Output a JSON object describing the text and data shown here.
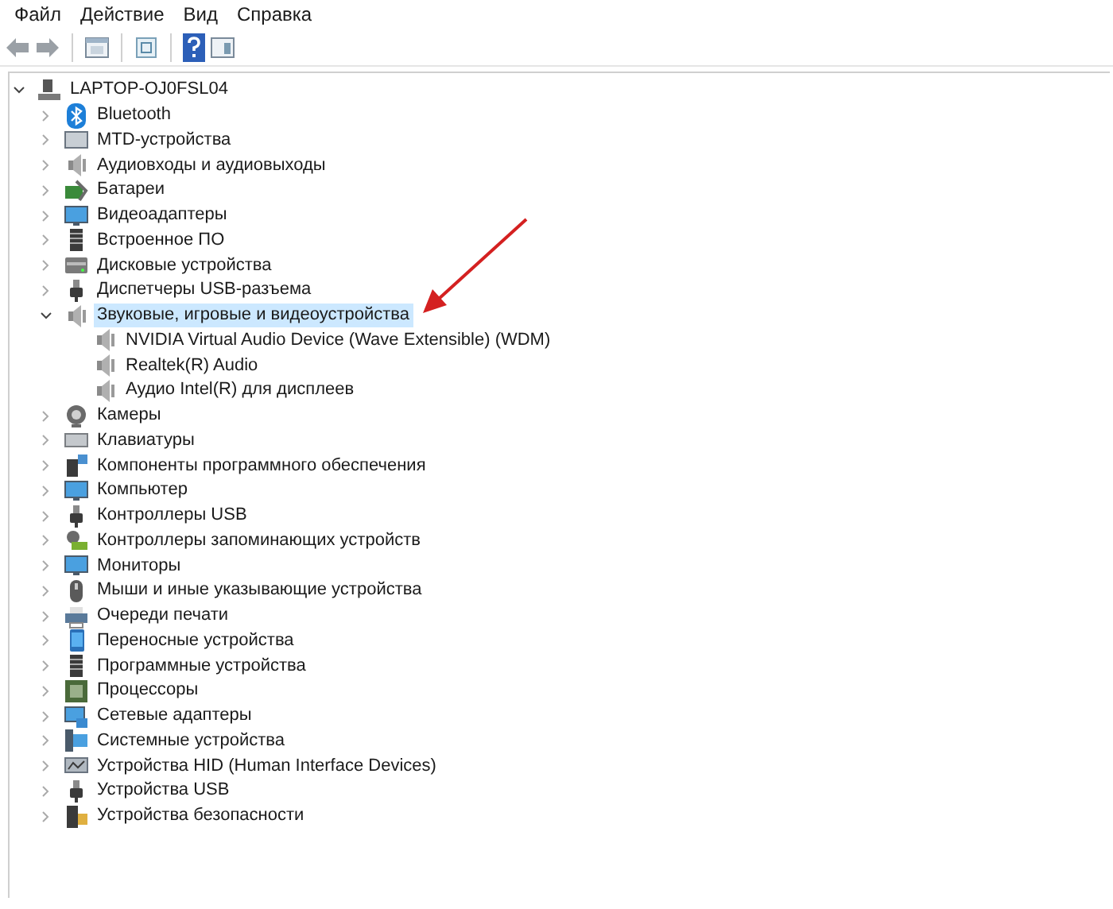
{
  "menu": [
    {
      "label": "Файл"
    },
    {
      "label": "Действие"
    },
    {
      "label": "Вид"
    },
    {
      "label": "Справка"
    }
  ],
  "tree": {
    "label": "LAPTOP-OJ0FSL04",
    "expanded": true,
    "children": [
      {
        "label": "Bluetooth",
        "expanded": false,
        "selected": false
      },
      {
        "label": "MTD-устройства",
        "expanded": false,
        "selected": false
      },
      {
        "label": "Аудиовходы и аудиовыходы",
        "expanded": false,
        "selected": false
      },
      {
        "label": "Батареи",
        "expanded": false,
        "selected": false
      },
      {
        "label": "Видеоадаптеры",
        "expanded": false,
        "selected": false
      },
      {
        "label": "Встроенное ПО",
        "expanded": false,
        "selected": false
      },
      {
        "label": "Дисковые устройства",
        "expanded": false,
        "selected": false
      },
      {
        "label": "Диспетчеры USB-разъема",
        "expanded": false,
        "selected": false
      },
      {
        "label": "Звуковые, игровые и видеоустройства",
        "expanded": true,
        "selected": true,
        "children": [
          {
            "label": "NVIDIA Virtual Audio Device (Wave Extensible) (WDM)"
          },
          {
            "label": "Realtek(R) Audio"
          },
          {
            "label": "Аудио Intel(R) для дисплеев"
          }
        ]
      },
      {
        "label": "Камеры",
        "expanded": false,
        "selected": false
      },
      {
        "label": "Клавиатуры",
        "expanded": false,
        "selected": false
      },
      {
        "label": "Компоненты программного обеспечения",
        "expanded": false,
        "selected": false
      },
      {
        "label": "Компьютер",
        "expanded": false,
        "selected": false
      },
      {
        "label": "Контроллеры USB",
        "expanded": false,
        "selected": false
      },
      {
        "label": "Контроллеры запоминающих устройств",
        "expanded": false,
        "selected": false
      },
      {
        "label": "Мониторы",
        "expanded": false,
        "selected": false
      },
      {
        "label": "Мыши и иные указывающие устройства",
        "expanded": false,
        "selected": false
      },
      {
        "label": "Очереди печати",
        "expanded": false,
        "selected": false
      },
      {
        "label": "Переносные устройства",
        "expanded": false,
        "selected": false
      },
      {
        "label": "Программные устройства",
        "expanded": false,
        "selected": false
      },
      {
        "label": "Процессоры",
        "expanded": false,
        "selected": false
      },
      {
        "label": "Сетевые адаптеры",
        "expanded": false,
        "selected": false
      },
      {
        "label": "Системные устройства",
        "expanded": false,
        "selected": false
      },
      {
        "label": "Устройства HID (Human Interface Devices)",
        "expanded": false,
        "selected": false
      },
      {
        "label": "Устройства USB",
        "expanded": false,
        "selected": false
      },
      {
        "label": "Устройства безопасности",
        "expanded": false,
        "selected": false
      }
    ]
  }
}
